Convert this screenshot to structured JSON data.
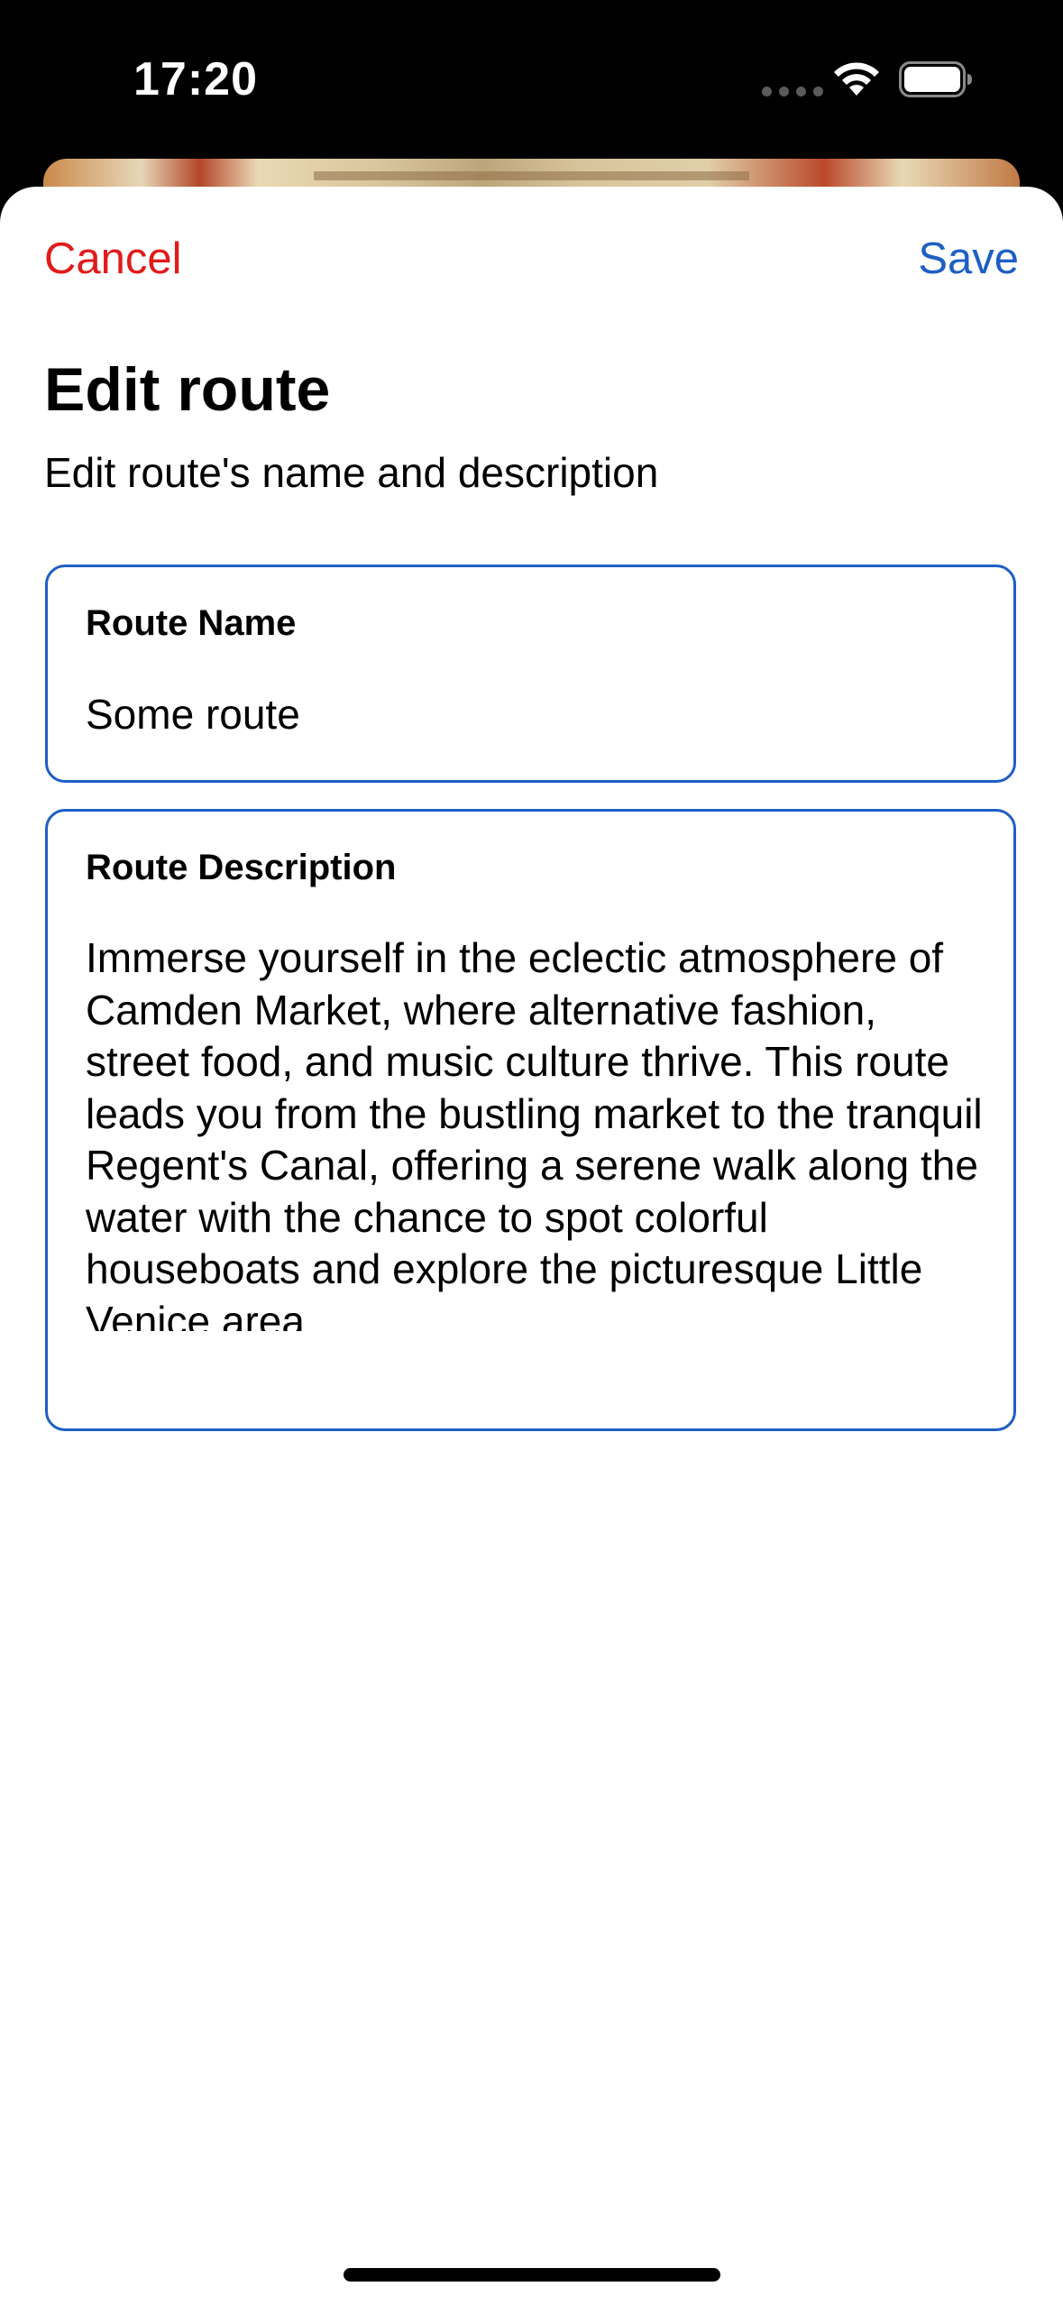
{
  "status_bar": {
    "time": "17:20",
    "icons": [
      "cellular-dots-icon",
      "wifi-icon",
      "battery-icon"
    ]
  },
  "nav": {
    "cancel_label": "Cancel",
    "save_label": "Save"
  },
  "header": {
    "title": "Edit route",
    "subtitle": "Edit route's name and description"
  },
  "form": {
    "name_field": {
      "label": "Route Name",
      "value": "Some route"
    },
    "description_field": {
      "label": "Route Description",
      "value": "Immerse yourself in the eclectic atmosphere of Camden Market, where alternative fashion, street food, and music culture thrive. This route leads you from the bustling market to the tranquil Regent's Canal, offering a serene walk along the water with the chance to spot colorful houseboats and explore the picturesque Little Venice area."
    }
  },
  "colors": {
    "cancel": "#e01b1b",
    "accent": "#1d5fc4",
    "field_border": "#1d5fc4"
  }
}
